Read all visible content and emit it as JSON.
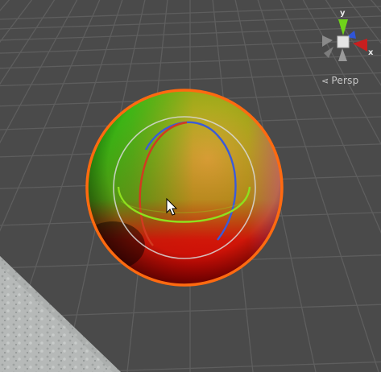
{
  "scene_view": {
    "projection_label": "Persp",
    "projection_glyph": "⋖",
    "background_color": "#4a4a4a",
    "grid_color": "#5e5e5e",
    "selection_outline_color": "#ff6a10"
  },
  "gizmo": {
    "axes": {
      "y_label": "y",
      "x_label": "x",
      "y_color": "#6fd31a",
      "x_color": "#c81f1f",
      "z_color": "#2f55d8"
    }
  },
  "rotate_handles": {
    "x_color": "#d23a20",
    "y_color": "#8fe01e",
    "z_color": "#3b5bd9",
    "view_circle_color": "#d8d8d8"
  }
}
